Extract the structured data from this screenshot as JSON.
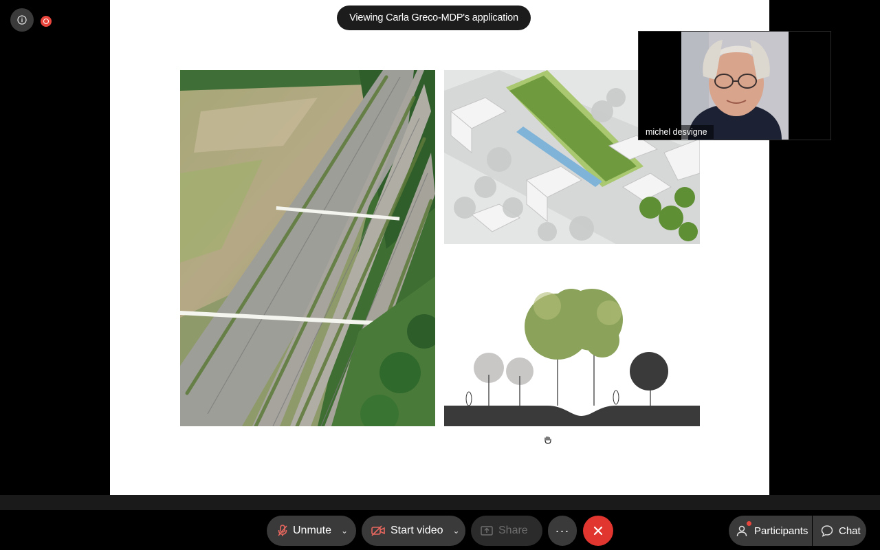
{
  "meeting": {
    "banner_text": "Viewing Carla Greco-MDP's application",
    "video_participant_name": "michel desvigne"
  },
  "icons": {
    "info": "info-icon",
    "recording": "recording-icon",
    "cursor": "hand-cursor-icon",
    "mic_muted": "mic-off-icon",
    "camera_off": "camera-off-icon",
    "share": "share-screen-icon",
    "more": "more-icon",
    "leave": "close-icon",
    "participants": "participants-icon",
    "chat": "chat-icon"
  },
  "toolbar": {
    "unmute_label": "Unmute",
    "start_video_label": "Start video",
    "share_label": "Share",
    "more_label": "···",
    "participants_label": "Participants",
    "chat_label": "Chat"
  },
  "colors": {
    "leave": "#e0362f",
    "recording": "#e8453c",
    "mic_icon": "#e8675f",
    "toolbar_button": "#3a3a3a"
  }
}
